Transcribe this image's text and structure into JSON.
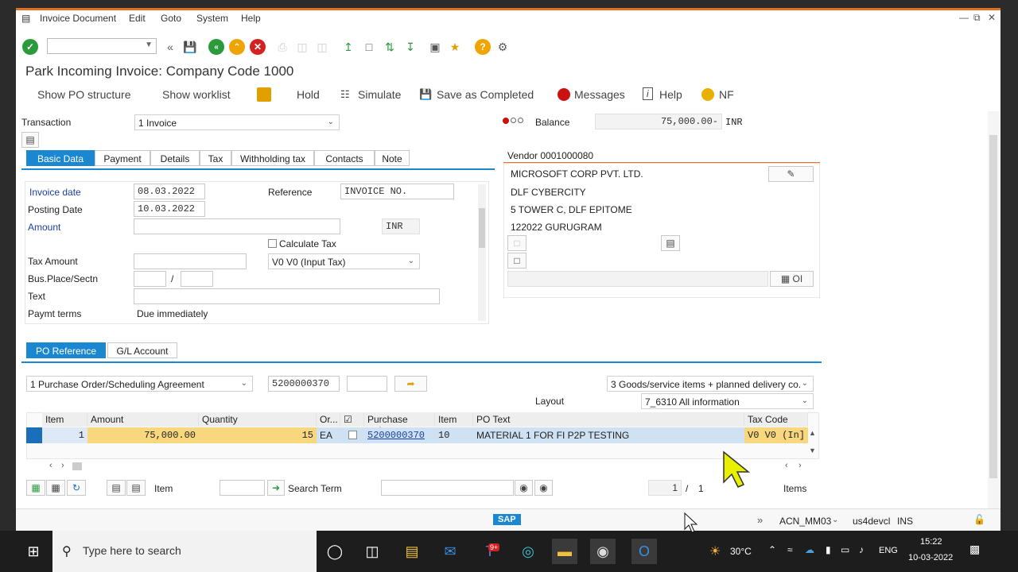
{
  "menu": [
    "Invoice Document",
    "Edit",
    "Goto",
    "System",
    "Help"
  ],
  "title": "Park Incoming Invoice: Company Code 1000",
  "app_toolbar": {
    "show_po_structure": "Show PO structure",
    "show_worklist": "Show worklist",
    "hold": "Hold",
    "simulate": "Simulate",
    "save_as_completed": "Save as Completed",
    "messages": "Messages",
    "help": "Help",
    "nf": "NF"
  },
  "header": {
    "transaction_label": "Transaction",
    "transaction_value": "1 Invoice",
    "balance_label": "Balance",
    "balance_value": "75,000.00-",
    "balance_currency": "INR"
  },
  "tabs": [
    "Basic Data",
    "Payment",
    "Details",
    "Tax",
    "Withholding tax",
    "Contacts",
    "Note"
  ],
  "basic_data": {
    "invoice_date_label": "Invoice date",
    "invoice_date": "08.03.2022",
    "posting_date_label": "Posting Date",
    "posting_date": "10.03.2022",
    "reference_label": "Reference",
    "reference": "INVOICE NO.",
    "amount_label": "Amount",
    "amount": "",
    "currency": "INR",
    "calculate_tax_label": "Calculate Tax",
    "tax_amount_label": "Tax Amount",
    "tax_code": "V0 V0 (Input Tax)",
    "bus_place_label": "Bus.Place/Sectn",
    "separator": "/",
    "text_label": "Text",
    "paymt_terms_label": "Paymt terms",
    "paymt_terms": "Due immediately"
  },
  "vendor": {
    "header": "Vendor 0001000080",
    "name": "MICROSOFT CORP PVT. LTD.",
    "line1": "DLF CYBERCITY",
    "line2": "5 TOWER C, DLF EPITOME",
    "line3": "122022 GURUGRAM",
    "oi_label": "OI"
  },
  "po_tabs": [
    "PO Reference",
    "G/L Account"
  ],
  "po": {
    "doc_type": "1 Purchase Order/Scheduling Agreement",
    "po_number": "5200000370",
    "items_type": "3 Goods/service items + planned delivery co...",
    "layout_label": "Layout",
    "layout_value": "7_6310 All information"
  },
  "table": {
    "headers": [
      "Item",
      "Amount",
      "Quantity",
      "Or...",
      "",
      "Purchase order",
      "Item",
      "PO Text",
      "Tax Code"
    ],
    "rows": [
      {
        "item": "1",
        "amount": "75,000.00",
        "quantity": "15",
        "order_unit": "EA",
        "purchase_order": "5200000370",
        "po_item": "10",
        "po_text": "MATERIAL 1 FOR FI P2P TESTING",
        "tax_code": "V0 V0 (In]"
      }
    ]
  },
  "bottom": {
    "item_label": "Item",
    "search_term_label": "Search Term",
    "page_current": "1",
    "page_sep": "/",
    "page_total": "1",
    "items_label": "Items"
  },
  "status": {
    "sap": "SAP",
    "system": "ACN_MM03",
    "server": "us4devcl",
    "mode": "INS"
  },
  "taskbar": {
    "search_placeholder": "Type here to search",
    "temp": "30°C",
    "lang": "ENG",
    "time": "15:22",
    "date": "10-03-2022",
    "teams_badge": "9+"
  }
}
